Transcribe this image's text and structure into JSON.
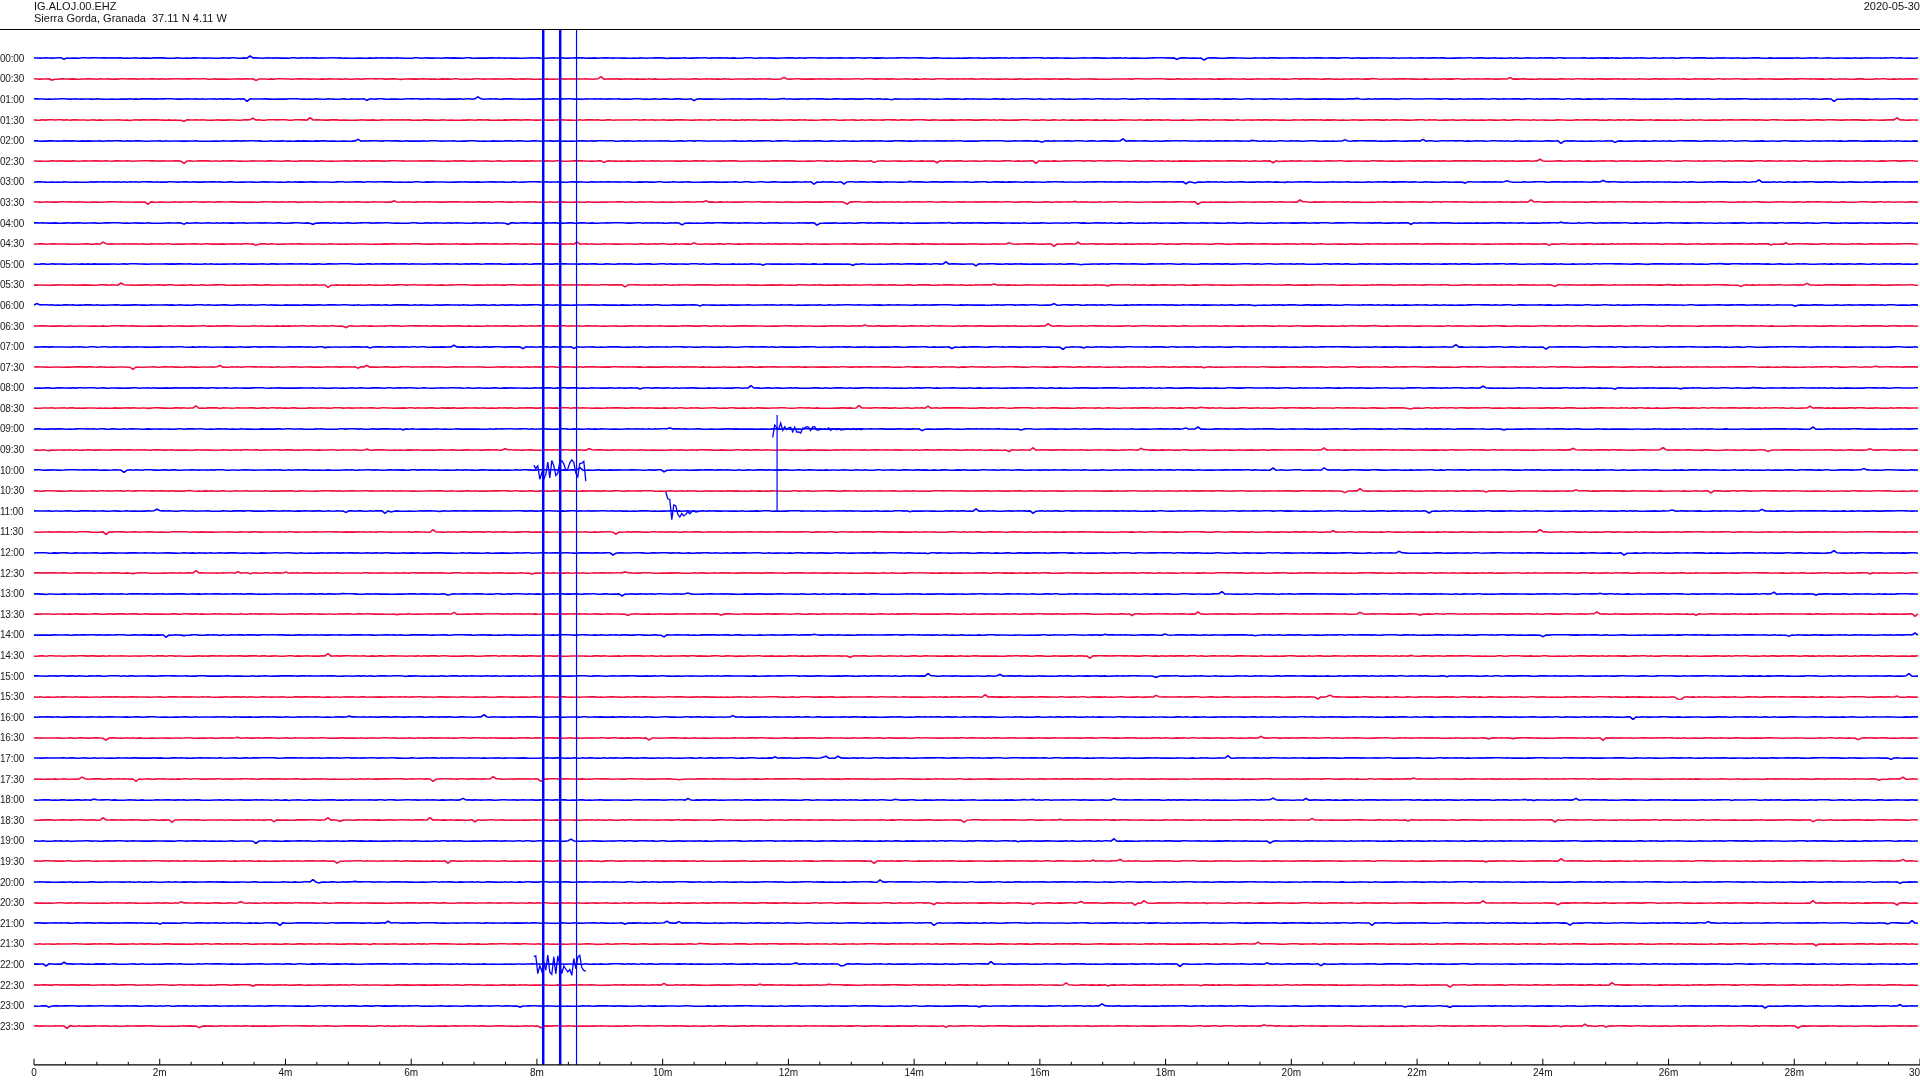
{
  "header": {
    "station": "IG.ALOJ.00.EHZ",
    "location": "Sierra Gorda, Granada  37.11 N 4.11 W",
    "date": "2020-05-30"
  },
  "helicorder": {
    "rows": [
      {
        "label": "00:00",
        "color": "#0000ff"
      },
      {
        "label": "00:30",
        "color": "#f01040"
      },
      {
        "label": "01:00",
        "color": "#0000ff"
      },
      {
        "label": "01:30",
        "color": "#f01040"
      },
      {
        "label": "02:00",
        "color": "#0000ff"
      },
      {
        "label": "02:30",
        "color": "#f01040"
      },
      {
        "label": "03:00",
        "color": "#0000ff"
      },
      {
        "label": "03:30",
        "color": "#f01040"
      },
      {
        "label": "04:00",
        "color": "#0000ff"
      },
      {
        "label": "04:30",
        "color": "#f01040"
      },
      {
        "label": "05:00",
        "color": "#0000ff"
      },
      {
        "label": "05:30",
        "color": "#f01040"
      },
      {
        "label": "06:00",
        "color": "#0000ff"
      },
      {
        "label": "06:30",
        "color": "#f01040"
      },
      {
        "label": "07:00",
        "color": "#0000ff"
      },
      {
        "label": "07:30",
        "color": "#f01040"
      },
      {
        "label": "08:00",
        "color": "#0000ff"
      },
      {
        "label": "08:30",
        "color": "#f01040"
      },
      {
        "label": "09:00",
        "color": "#0000ff"
      },
      {
        "label": "09:30",
        "color": "#f01040"
      },
      {
        "label": "10:00",
        "color": "#0000ff"
      },
      {
        "label": "10:30",
        "color": "#f01040"
      },
      {
        "label": "11:00",
        "color": "#0000ff"
      },
      {
        "label": "11:30",
        "color": "#f01040"
      },
      {
        "label": "12:00",
        "color": "#0000ff"
      },
      {
        "label": "12:30",
        "color": "#f01040"
      },
      {
        "label": "13:00",
        "color": "#0000ff"
      },
      {
        "label": "13:30",
        "color": "#f01040"
      },
      {
        "label": "14:00",
        "color": "#0000ff"
      },
      {
        "label": "14:30",
        "color": "#f01040"
      },
      {
        "label": "15:00",
        "color": "#0000ff"
      },
      {
        "label": "15:30",
        "color": "#f01040"
      },
      {
        "label": "16:00",
        "color": "#0000ff"
      },
      {
        "label": "16:30",
        "color": "#f01040"
      },
      {
        "label": "17:00",
        "color": "#0000ff"
      },
      {
        "label": "17:30",
        "color": "#f01040"
      },
      {
        "label": "18:00",
        "color": "#0000ff"
      },
      {
        "label": "18:30",
        "color": "#f01040"
      },
      {
        "label": "19:00",
        "color": "#0000ff"
      },
      {
        "label": "19:30",
        "color": "#f01040"
      },
      {
        "label": "20:00",
        "color": "#0000ff"
      },
      {
        "label": "20:30",
        "color": "#f01040"
      },
      {
        "label": "21:00",
        "color": "#0000ff"
      },
      {
        "label": "21:30",
        "color": "#f01040"
      },
      {
        "label": "22:00",
        "color": "#0000ff"
      },
      {
        "label": "22:30",
        "color": "#f01040"
      },
      {
        "label": "23:00",
        "color": "#0000ff"
      },
      {
        "label": "23:30",
        "color": "#f01040"
      }
    ],
    "x_axis_labels": [
      "0",
      "2m",
      "4m",
      "6m",
      "8m",
      "10m",
      "12m",
      "14m",
      "16m",
      "18m",
      "20m",
      "22m",
      "24m",
      "26m",
      "28m",
      "30"
    ]
  }
}
